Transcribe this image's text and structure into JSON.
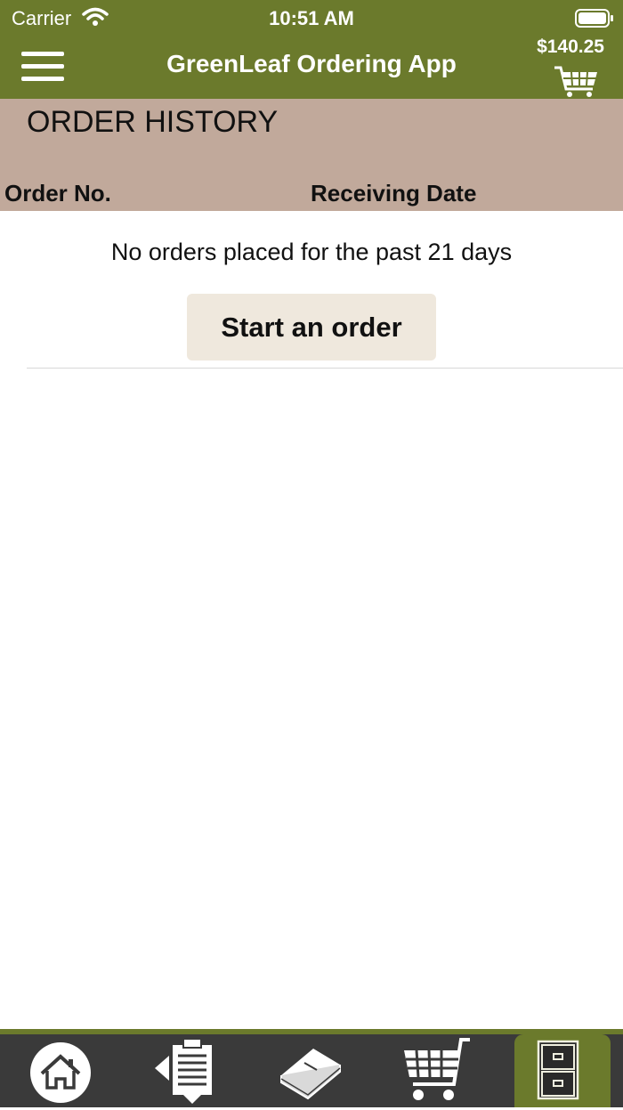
{
  "status_bar": {
    "carrier": "Carrier",
    "time": "10:51 AM"
  },
  "header": {
    "title": "GreenLeaf Ordering App",
    "cart_total": "$140.25"
  },
  "page": {
    "title": "ORDER HISTORY",
    "columns": [
      "Order No.",
      "Receiving Date"
    ],
    "empty_message": "No orders placed for the past 21 days",
    "start_button": "Start an order"
  },
  "tabbar": {
    "tabs": [
      {
        "icon": "home-icon"
      },
      {
        "icon": "order-list-icon"
      },
      {
        "icon": "catalog-book-icon"
      },
      {
        "icon": "cart-icon"
      },
      {
        "icon": "order-history-cabinet-icon",
        "active": true
      }
    ]
  },
  "colors": {
    "header": "#6b7a2c",
    "subheader": "#c1a99b",
    "button": "#efe8dd",
    "tabbar": "#3a3a3a"
  }
}
